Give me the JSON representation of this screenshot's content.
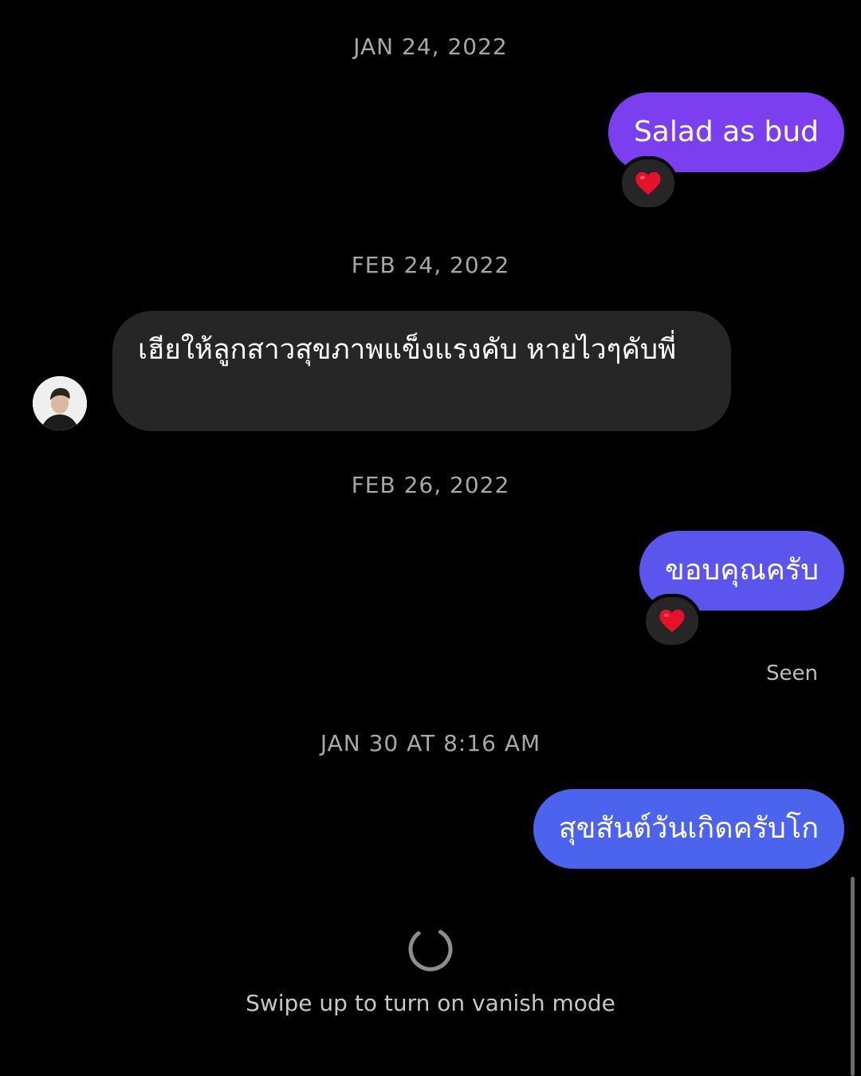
{
  "thread": {
    "items": [
      {
        "type": "date",
        "text": "JAN 24, 2022"
      },
      {
        "type": "message",
        "direction": "out",
        "text": "Salad as bud",
        "reaction": "heart"
      },
      {
        "type": "date",
        "text": "FEB 24, 2022"
      },
      {
        "type": "message",
        "direction": "in",
        "text": "เฮียให้ลูกสาวสุขภาพแข็งแรงคับ หายไวๆคับพี่"
      },
      {
        "type": "date",
        "text": "FEB 26, 2022"
      },
      {
        "type": "message",
        "direction": "out",
        "text": "ขอบคุณครับ",
        "reaction": "heart"
      },
      {
        "type": "status",
        "text": "Seen"
      },
      {
        "type": "date",
        "text": "JAN 30 AT 8:16 AM"
      },
      {
        "type": "message",
        "direction": "out",
        "text": "สุขสันต์วันเกิดครับโก"
      }
    ]
  },
  "footer": {
    "vanish_hint": "Swipe up to turn on vanish mode",
    "loading_icon": "spinner-icon"
  },
  "colors": {
    "background": "#000000",
    "incoming_bubble": "#262626",
    "outgoing_gradient_top": "#7b3ff0",
    "outgoing_gradient_mid": "#5b55ee",
    "outgoing_gradient_bottom": "#4c63ee",
    "reaction_heart": "#e8112d"
  }
}
